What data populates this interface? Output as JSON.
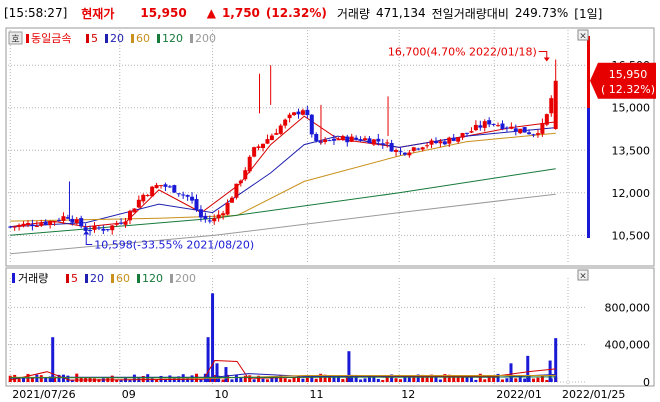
{
  "header": {
    "time": "[15:58:27]",
    "current_label": "현재가",
    "price": "15,950",
    "change_arrow": "▲",
    "change": "1,750",
    "change_pct": "(12.32%)",
    "volume_label": "거래량",
    "volume": "471,134",
    "prev_vol_label": "전일거래량대비",
    "prev_vol_pct": "249.73%",
    "period": "[1일]"
  },
  "colors": {
    "up": "#e60000",
    "down": "#1a1ad6",
    "ma5": "#d40000",
    "ma20": "#2020b0",
    "ma60": "#c8901c",
    "ma120": "#157a3a",
    "ma200": "#9a9a9a",
    "grid": "#b4b4b4"
  },
  "chart_data": [
    {
      "type": "candlestick",
      "legend_title": "동일금속",
      "legend_icon": "호",
      "legend": [
        {
          "name": "5",
          "color": "#d40000"
        },
        {
          "name": "20",
          "color": "#2020b0"
        },
        {
          "name": "60",
          "color": "#c8901c"
        },
        {
          "name": "120",
          "color": "#157a3a"
        },
        {
          "name": "200",
          "color": "#9a9a9a"
        }
      ],
      "ylim": [
        9700,
        17600
      ],
      "y_ticks": [
        {
          "value": 10500,
          "label": "10,500"
        },
        {
          "value": 12000,
          "label": "12,000"
        },
        {
          "value": 13500,
          "label": "13,500"
        },
        {
          "value": 15000,
          "label": "15,000"
        },
        {
          "value": 16500,
          "label": "16,500"
        }
      ],
      "current_price": {
        "value": 15950,
        "label": "15,950",
        "pct": "( 12.32%)"
      },
      "annotations": [
        {
          "label": "16,700(4.70% 2022/01/18)",
          "x": 2022.047,
          "value": 16700
        },
        {
          "label": "10,598(-33.55% 2021/08/20)",
          "x": 2021.635,
          "value": 10598
        }
      ],
      "x_range": [
        2021.565,
        2022.083
      ],
      "x_ticks": [
        {
          "x": 2021.567,
          "label": "2021/07/26"
        },
        {
          "x": 2021.665,
          "label": "09"
        },
        {
          "x": 2021.748,
          "label": "10"
        },
        {
          "x": 2021.833,
          "label": "11"
        },
        {
          "x": 2021.915,
          "label": "12"
        },
        {
          "x": 2022.0,
          "label": "2022/01"
        },
        {
          "x": 2022.066,
          "label": "2022/01/25"
        }
      ],
      "ohlc_anchors": [
        [
          2021.567,
          10800
        ],
        [
          2021.585,
          10900
        ],
        [
          2021.605,
          11000
        ],
        [
          2021.618,
          11200
        ],
        [
          2021.635,
          10700
        ],
        [
          2021.655,
          10750
        ],
        [
          2021.67,
          11100
        ],
        [
          2021.685,
          11900
        ],
        [
          2021.7,
          12300
        ],
        [
          2021.715,
          12100
        ],
        [
          2021.728,
          11800
        ],
        [
          2021.738,
          11100
        ],
        [
          2021.748,
          11000
        ],
        [
          2021.76,
          11500
        ],
        [
          2021.772,
          12400
        ],
        [
          2021.785,
          13500
        ],
        [
          2021.8,
          14000
        ],
        [
          2021.815,
          14600
        ],
        [
          2021.83,
          15000
        ],
        [
          2021.84,
          13700
        ],
        [
          2021.86,
          13900
        ],
        [
          2021.885,
          13900
        ],
        [
          2021.9,
          13800
        ],
        [
          2021.915,
          13400
        ],
        [
          2021.935,
          13700
        ],
        [
          2021.955,
          13800
        ],
        [
          2021.975,
          14100
        ],
        [
          2021.995,
          14500
        ],
        [
          2022.015,
          14300
        ],
        [
          2022.035,
          14100
        ],
        [
          2022.045,
          14400
        ],
        [
          2022.055,
          15950
        ]
      ],
      "ma_lines": [
        {
          "name": "5",
          "points": [
            [
              2021.567,
              10800
            ],
            [
              2021.605,
              11000
            ],
            [
              2021.635,
              10800
            ],
            [
              2021.67,
              10950
            ],
            [
              2021.7,
              12100
            ],
            [
              2021.738,
              11300
            ],
            [
              2021.772,
              12300
            ],
            [
              2021.8,
              13700
            ],
            [
              2021.83,
              14700
            ],
            [
              2021.86,
              13900
            ],
            [
              2021.915,
              13600
            ],
            [
              2021.975,
              14000
            ],
            [
              2022.015,
              14300
            ],
            [
              2022.055,
              14500
            ]
          ]
        },
        {
          "name": "20",
          "points": [
            [
              2021.567,
              10800
            ],
            [
              2021.635,
              10950
            ],
            [
              2021.7,
              11600
            ],
            [
              2021.748,
              11300
            ],
            [
              2021.8,
              12700
            ],
            [
              2021.83,
              13700
            ],
            [
              2021.86,
              14000
            ],
            [
              2021.915,
              13600
            ],
            [
              2021.975,
              14000
            ],
            [
              2022.055,
              14300
            ]
          ]
        },
        {
          "name": "60",
          "points": [
            [
              2021.567,
              11000
            ],
            [
              2021.7,
              11100
            ],
            [
              2021.77,
              11200
            ],
            [
              2021.83,
              12400
            ],
            [
              2021.915,
              13300
            ],
            [
              2021.975,
              13800
            ],
            [
              2022.055,
              14100
            ]
          ]
        },
        {
          "name": "120",
          "points": [
            [
              2021.567,
              10500
            ],
            [
              2021.75,
              11100
            ],
            [
              2021.915,
              12000
            ],
            [
              2022.055,
              12850
            ]
          ]
        },
        {
          "name": "200",
          "points": [
            [
              2021.567,
              9850
            ],
            [
              2021.75,
              10500
            ],
            [
              2021.915,
              11300
            ],
            [
              2022.055,
              11950
            ]
          ]
        }
      ]
    },
    {
      "type": "bar",
      "legend_title": "거래량",
      "legend": [
        {
          "name": "5",
          "color": "#d40000"
        },
        {
          "name": "20",
          "color": "#2020b0"
        },
        {
          "name": "60",
          "color": "#c8901c"
        },
        {
          "name": "120",
          "color": "#157a3a"
        },
        {
          "name": "200",
          "color": "#9a9a9a"
        }
      ],
      "ylim": [
        0,
        1050000
      ],
      "y_ticks": [
        {
          "value": 0,
          "label": "0"
        },
        {
          "value": 400000,
          "label": "400,000"
        },
        {
          "value": 800000,
          "label": "800,000"
        }
      ],
      "spikes": [
        [
          2021.605,
          480000
        ],
        [
          2021.748,
          950000
        ],
        [
          2021.744,
          480000
        ],
        [
          2021.752,
          200000
        ],
        [
          2021.76,
          160000
        ],
        [
          2021.87,
          330000
        ],
        [
          2022.015,
          200000
        ],
        [
          2022.03,
          280000
        ],
        [
          2022.05,
          230000
        ],
        [
          2022.055,
          470000
        ]
      ],
      "ma_lines": [
        {
          "name": "5",
          "points": [
            [
              2021.567,
              20000
            ],
            [
              2021.6,
              110000
            ],
            [
              2021.62,
              20000
            ],
            [
              2021.74,
              30000
            ],
            [
              2021.75,
              230000
            ],
            [
              2021.77,
              220000
            ],
            [
              2021.78,
              40000
            ],
            [
              2021.87,
              60000
            ],
            [
              2022.0,
              60000
            ],
            [
              2022.03,
              110000
            ],
            [
              2022.055,
              140000
            ]
          ]
        },
        {
          "name": "20",
          "points": [
            [
              2021.567,
              40000
            ],
            [
              2021.62,
              50000
            ],
            [
              2021.75,
              50000
            ],
            [
              2021.78,
              90000
            ],
            [
              2021.83,
              60000
            ],
            [
              2022.0,
              50000
            ],
            [
              2022.055,
              80000
            ]
          ]
        },
        {
          "name": "60",
          "points": [
            [
              2021.567,
              50000
            ],
            [
              2021.75,
              40000
            ],
            [
              2021.83,
              70000
            ],
            [
              2022.055,
              70000
            ]
          ]
        },
        {
          "name": "120",
          "points": [
            [
              2021.567,
              45000
            ],
            [
              2022.055,
              55000
            ]
          ]
        }
      ]
    }
  ]
}
